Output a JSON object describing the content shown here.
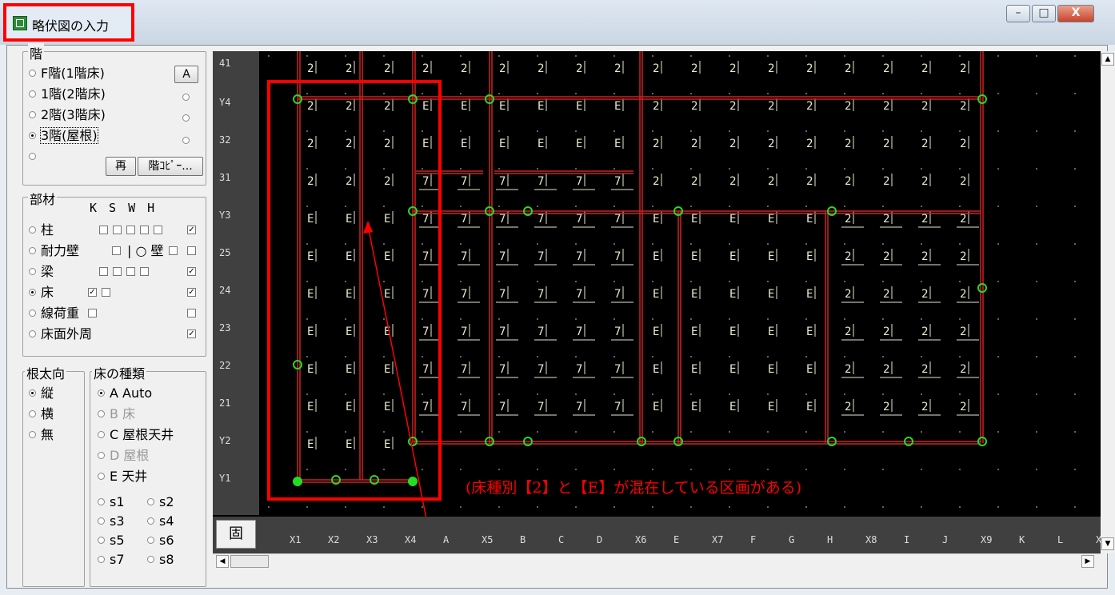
{
  "window": {
    "title": "略伏図の入力",
    "controls": {
      "minimize": "–",
      "maximize": "□",
      "close": "X"
    }
  },
  "floor_group": {
    "title": "階",
    "options": [
      "F階(1階床)",
      "1階(2階床)",
      "2階(3階床)",
      "3階(屋根)",
      ""
    ],
    "selected_index": 3,
    "button_a": "A",
    "button_redo": "再",
    "button_copy": "階ｺﾋﾟｰ..."
  },
  "member_group": {
    "title": "部材",
    "header": "K S W H",
    "rows": [
      {
        "label": "柱",
        "checks": [
          false,
          false,
          false,
          false,
          false
        ],
        "h": true
      },
      {
        "label": "耐力壁",
        "checks": [
          false
        ],
        "extra_label": "| ○ 壁",
        "h": false
      },
      {
        "label": "梁",
        "checks": [
          false,
          false,
          false,
          false
        ],
        "h": true
      },
      {
        "label": "床",
        "checks": [
          true,
          false
        ],
        "h": true
      },
      {
        "label": "線荷重",
        "checks": [
          false
        ],
        "h": false
      },
      {
        "label": "床面外周",
        "checks": [],
        "h": true
      }
    ],
    "selected_index": 3
  },
  "joist_group": {
    "title": "根太向",
    "options": [
      "縦",
      "横",
      "無"
    ],
    "selected_index": 0
  },
  "floor_type_group": {
    "title": "床の種類",
    "options": [
      "A Auto",
      "B 床",
      "C 屋根天井",
      "D 屋根",
      "E 天井"
    ],
    "disabled": [
      false,
      true,
      false,
      true,
      false
    ],
    "selected_index": 0,
    "s_options": [
      [
        "s1",
        "s2"
      ],
      [
        "s3",
        "s4"
      ],
      [
        "s5",
        "s6"
      ],
      [
        "s7",
        "s8"
      ]
    ]
  },
  "grid": {
    "y_labels": [
      "41",
      "Y4",
      "32",
      "31",
      "Y3",
      "25",
      "24",
      "23",
      "22",
      "21",
      "Y2",
      "Y1"
    ],
    "x_labels": [
      "X1",
      "X2",
      "X3",
      "X4",
      "A",
      "X5",
      "B",
      "C",
      "D",
      "X6",
      "E",
      "X7",
      "F",
      "G",
      "H",
      "X8",
      "I",
      "J",
      "X9",
      "K",
      "L",
      "X"
    ],
    "fix_button": "固",
    "annotation": "(床種別【2】と【E】が混在している区画がある)",
    "cell_rows": [
      [
        "2",
        "2",
        "2",
        "2",
        "2",
        "2",
        "2",
        "2",
        "2",
        "2",
        "2",
        "2",
        "2",
        "2",
        "2",
        "2",
        "2",
        "2"
      ],
      [
        "2",
        "2",
        "2",
        "E",
        "E",
        "E",
        "E",
        "E",
        "E",
        "2",
        "2",
        "2",
        "2",
        "2",
        "2",
        "2",
        "2",
        "2"
      ],
      [
        "2",
        "2",
        "2",
        "E",
        "E",
        "E",
        "E",
        "E",
        "E",
        "2",
        "2",
        "2",
        "2",
        "2",
        "2",
        "2",
        "2",
        "2"
      ],
      [
        "2",
        "2",
        "2",
        "7",
        "7",
        "7",
        "7",
        "7",
        "7",
        "2",
        "2",
        "2",
        "2",
        "2",
        "2",
        "2",
        "2",
        "2"
      ],
      [
        "E",
        "E",
        "E",
        "7",
        "7",
        "7",
        "7",
        "7",
        "7",
        "E",
        "E",
        "E",
        "E",
        "E",
        "2",
        "2",
        "2",
        "2"
      ],
      [
        "E",
        "E",
        "E",
        "7",
        "7",
        "7",
        "7",
        "7",
        "7",
        "E",
        "E",
        "E",
        "E",
        "E",
        "2",
        "2",
        "2",
        "2"
      ],
      [
        "E",
        "E",
        "E",
        "7",
        "7",
        "7",
        "7",
        "7",
        "7",
        "E",
        "E",
        "E",
        "E",
        "E",
        "2",
        "2",
        "2",
        "2"
      ],
      [
        "E",
        "E",
        "E",
        "7",
        "7",
        "7",
        "7",
        "7",
        "7",
        "E",
        "E",
        "E",
        "E",
        "E",
        "2",
        "2",
        "2",
        "2"
      ],
      [
        "E",
        "E",
        "E",
        "7",
        "7",
        "7",
        "7",
        "7",
        "7",
        "E",
        "E",
        "E",
        "E",
        "E",
        "2",
        "2",
        "2",
        "2"
      ],
      [
        "E",
        "E",
        "E",
        "7",
        "7",
        "7",
        "7",
        "7",
        "7",
        "E",
        "E",
        "E",
        "E",
        "E",
        "2",
        "2",
        "2",
        "2"
      ],
      [
        "E",
        "E",
        "E",
        "",
        "",
        "",
        "",
        "",
        "",
        "",
        "",
        "",
        "",
        "",
        "",
        "",
        "",
        ""
      ]
    ]
  },
  "colors": {
    "canvas": "#000000",
    "grid_line": "#cc2222",
    "node": "#22dd22",
    "highlight": "#ff0000",
    "cell_text": "#e8e8d0",
    "dot": "#aaaaaa"
  }
}
